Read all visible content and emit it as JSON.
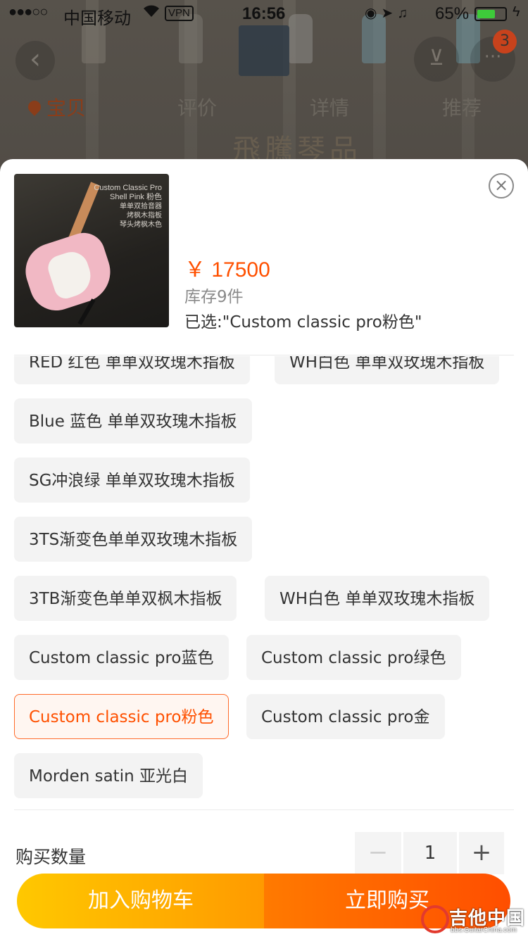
{
  "status_bar": {
    "signal": "●●●○○",
    "carrier": "中国移动",
    "vpn": "VPN",
    "time": "16:56",
    "battery_percent": "65%",
    "battery_level": 0.65
  },
  "nav": {
    "back_icon": "chevron-left-icon",
    "cart_icon": "cart-icon",
    "more_icon": "more-icon",
    "cart_badge": "3",
    "tabs": [
      {
        "label": "宝贝",
        "active": true
      },
      {
        "label": "评价",
        "active": false
      },
      {
        "label": "详情",
        "active": false
      },
      {
        "label": "推荐",
        "active": false
      }
    ]
  },
  "background": {
    "calligraphy": "飛騰琴品"
  },
  "product": {
    "thumb_text": [
      "Custom Classic Pro",
      "Shell Pink 粉色",
      "单单双拾音器",
      "烤枫木指板",
      "琴头烤枫木色"
    ],
    "price": "￥ 17500",
    "stock": "库存9件",
    "selected": "已选:\"Custom classic pro粉色\""
  },
  "options": [
    "RED 红色 单单双玫瑰木指板",
    "WH白色 单单双玫瑰木指板",
    "Blue 蓝色 单单双玫瑰木指板",
    "SG冲浪绿 单单双玫瑰木指板",
    "3TS渐变色单单双玫瑰木指板",
    "3TB渐变色单单双枫木指板",
    "WH白色 单单双玫瑰木指板",
    "Custom classic pro蓝色",
    "Custom classic pro绿色",
    "Custom classic pro粉色",
    "Custom classic pro金",
    "Morden satin 亚光白"
  ],
  "selected_option_index": 9,
  "quantity": {
    "label": "购买数量",
    "minus": "−",
    "value": "1",
    "plus": "+"
  },
  "actions": {
    "add_to_cart": "加入购物车",
    "buy_now": "立即购买"
  },
  "watermark": {
    "text": "吉他中国",
    "url": "bbs.GuitarChina.com"
  },
  "colors": {
    "accent": "#ff5000",
    "cart_gradient_start": "#ffc800",
    "buy_gradient_end": "#ff4e00"
  }
}
